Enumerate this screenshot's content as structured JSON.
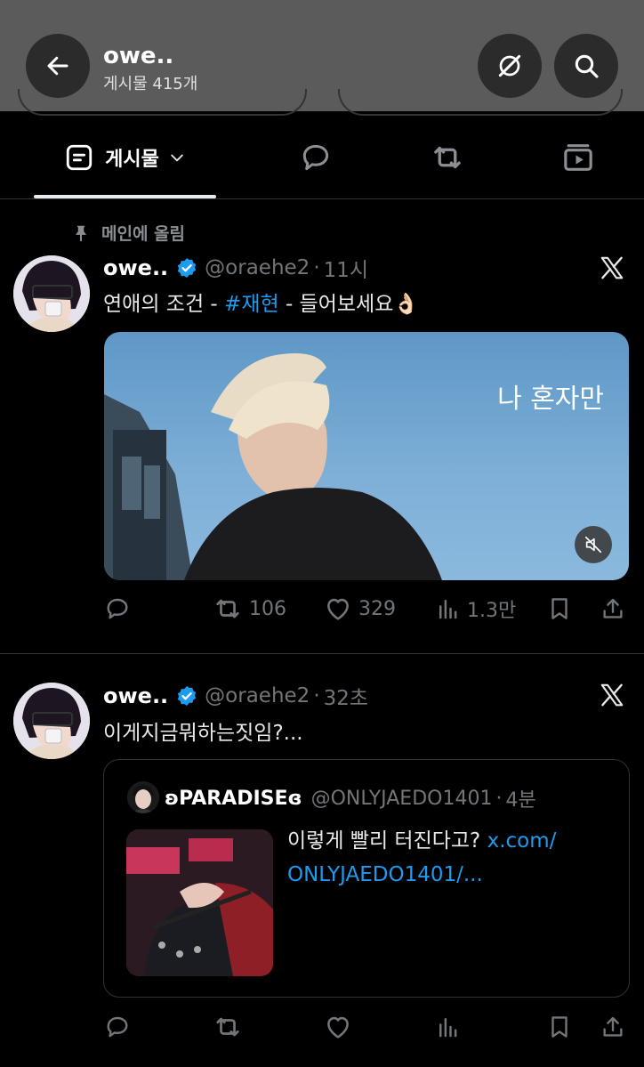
{
  "header": {
    "title": "owe..",
    "post_count": "게시물 415개",
    "icons": {
      "back": "arrow-left-icon",
      "grok": "grok-icon",
      "search": "search-icon"
    }
  },
  "tabs": [
    {
      "label": "게시물",
      "icon": "posts-icon",
      "selected": true
    },
    {
      "label": "",
      "icon": "reply-bubble-icon"
    },
    {
      "label": "",
      "icon": "repost-icon"
    },
    {
      "label": "",
      "icon": "media-icon"
    }
  ],
  "pinned_label": "메인에 올림",
  "tweets": [
    {
      "name": "owe..",
      "handle": "@oraehe2",
      "dot": "·",
      "time": "11시",
      "text_before": "연애의 조건 - ",
      "hashtag": "#재현",
      "text_after": " - 들어보세요👌🏻",
      "video_caption": "나 혼자만",
      "stats": {
        "reposts": "106",
        "likes": "329",
        "views": "1.3만"
      }
    },
    {
      "name": "owe..",
      "handle": "@oraehe2",
      "dot": "·",
      "time": "32초",
      "text": "이게지금뭐하는짓임?...",
      "quote": {
        "name": "ʚPARADISEɞ",
        "handle": "@ONLYJAEDO1401",
        "dot": "·",
        "time": "4분",
        "text": "이렇게 빨리 터진다고? ",
        "link_line1": "x.com/",
        "link_line2": "ONLYJAEDO1401/..."
      },
      "stats": {
        "reposts": "",
        "likes": "",
        "views": ""
      }
    }
  ],
  "colors": {
    "accent": "#1d9bf0",
    "header_bg": "#5b5b5b",
    "muted": "#71767b"
  }
}
